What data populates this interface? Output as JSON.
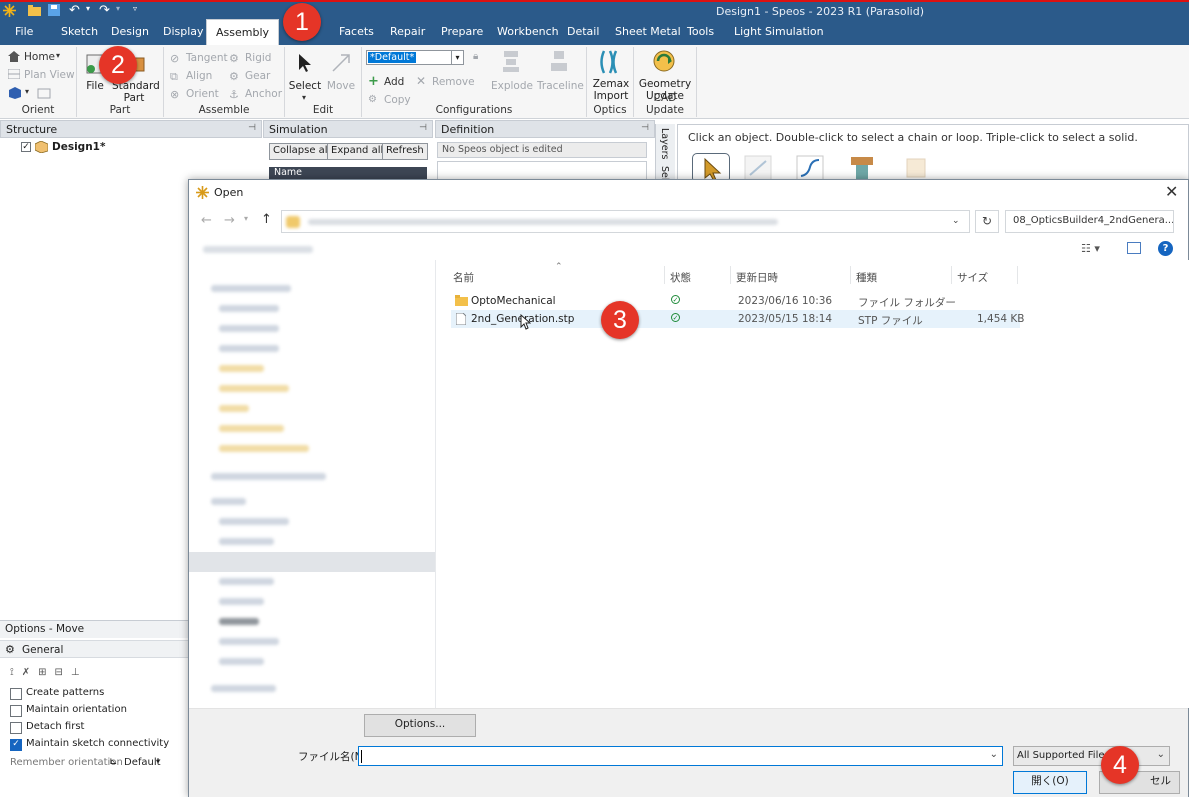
{
  "window": {
    "title": "Design1 - Speos - 2023 R1 (Parasolid)"
  },
  "ribbon_tabs": [
    {
      "label": "File"
    },
    {
      "label": "Sketch"
    },
    {
      "label": "Design"
    },
    {
      "label": "Display"
    },
    {
      "label": "Assembly"
    },
    {
      "label": "Facets"
    },
    {
      "label": "Repair"
    },
    {
      "label": "Prepare"
    },
    {
      "label": "Workbench"
    },
    {
      "label": "Detail"
    },
    {
      "label": "Sheet Metal"
    },
    {
      "label": "Tools"
    },
    {
      "label": "Light Simulation"
    }
  ],
  "ribbon": {
    "orient": {
      "home": "Home",
      "plan_view": "Plan View",
      "label": "Orient"
    },
    "part": {
      "file": "File",
      "standard_part": "Standard Part",
      "label": "Part"
    },
    "assemble": {
      "tangent": "Tangent",
      "rigid": "Rigid",
      "align": "Align",
      "gear": "Gear",
      "orient": "Orient",
      "anchor": "Anchor",
      "label": "Assemble"
    },
    "edit": {
      "select": "Select",
      "move": "Move",
      "label": "Edit"
    },
    "configurations": {
      "combo_value": "*Default*",
      "add": "Add",
      "remove": "Remove",
      "copy": "Copy",
      "explode": "Explode",
      "traceline": "Traceline",
      "label": "Configurations"
    },
    "optics": {
      "zemax_import": "Zemax Import",
      "label": "Optics"
    },
    "cad_update": {
      "geometry_update": "Geometry Update",
      "label": "CAD Update"
    }
  },
  "panes": {
    "structure": {
      "header": "Structure",
      "root_item": "Design1*"
    },
    "simulation": {
      "header": "Simulation",
      "collapse_all": "Collapse all",
      "expand_all": "Expand all",
      "refresh": "Refresh",
      "col_name": "Name"
    },
    "definition": {
      "header": "Definition",
      "placeholder": "No Speos object is edited"
    },
    "side_tabs": {
      "layers": "Layers",
      "selection": "Sel"
    },
    "canvas_hint": "Click an object.  Double-click to select a chain or loop.  Triple-click to select a solid."
  },
  "options": {
    "header": "Options - Move",
    "general": "General",
    "checkboxes": [
      {
        "label": "Create patterns",
        "checked": false
      },
      {
        "label": "Maintain orientation",
        "checked": false
      },
      {
        "label": "Detach first",
        "checked": false
      },
      {
        "label": "Maintain sketch connectivity",
        "checked": true
      }
    ],
    "remember_orientation": "Remember orientation",
    "remember_value": "Default"
  },
  "dialog": {
    "title": "Open",
    "search_placeholder": "08_OpticsBuilder4_2ndGenera...",
    "columns": {
      "name": "名前",
      "status": "状態",
      "modified": "更新日時",
      "type": "種類",
      "size": "サイズ"
    },
    "files": [
      {
        "name": "OptoMechanical",
        "modified": "2023/06/16 10:36",
        "type": "ファイル フォルダー",
        "size": "",
        "kind": "folder"
      },
      {
        "name": "2nd_Generation.stp",
        "modified": "2023/05/15 18:14",
        "type": "STP ファイル",
        "size": "1,454 KB",
        "kind": "file"
      }
    ],
    "options_button": "Options...",
    "filename_label": "ファイル名(N):",
    "filename_value": "",
    "filter": "All Supported Files (",
    "open_button": "開く(O)",
    "cancel_button_fragment": "セル"
  },
  "badges": [
    "1",
    "2",
    "3",
    "4"
  ],
  "colors": {
    "title_bar": "#2b5a8a",
    "badge": "#e53527",
    "status_ok": "#1f8b3a",
    "select_blue": "#0078d7"
  }
}
